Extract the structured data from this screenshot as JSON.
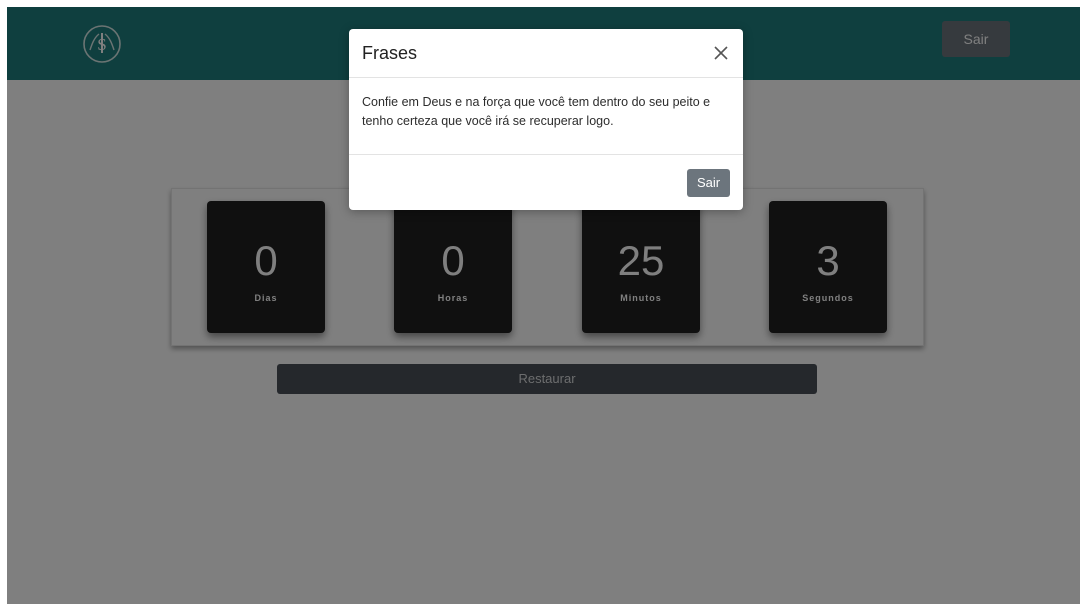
{
  "navbar": {
    "exit_label": "Sair",
    "color": "#1f7f7e"
  },
  "timer": {
    "tiles": [
      {
        "value": "0",
        "unit": "Dias"
      },
      {
        "value": "0",
        "unit": "Horas"
      },
      {
        "value": "25",
        "unit": "Minutos"
      },
      {
        "value": "3",
        "unit": "Segundos"
      }
    ]
  },
  "restore_label": "Restaurar",
  "modal": {
    "title": "Frases",
    "message": "Confie em Deus e na força que você tem dentro do seu peito e tenho certeza que você irá se recuperar logo.",
    "exit_label": "Sair",
    "close_icon": "close-icon"
  },
  "colors": {
    "accent": "#1f7f7e",
    "secondary_button": "#6c757d",
    "tile_background": "#202020"
  }
}
